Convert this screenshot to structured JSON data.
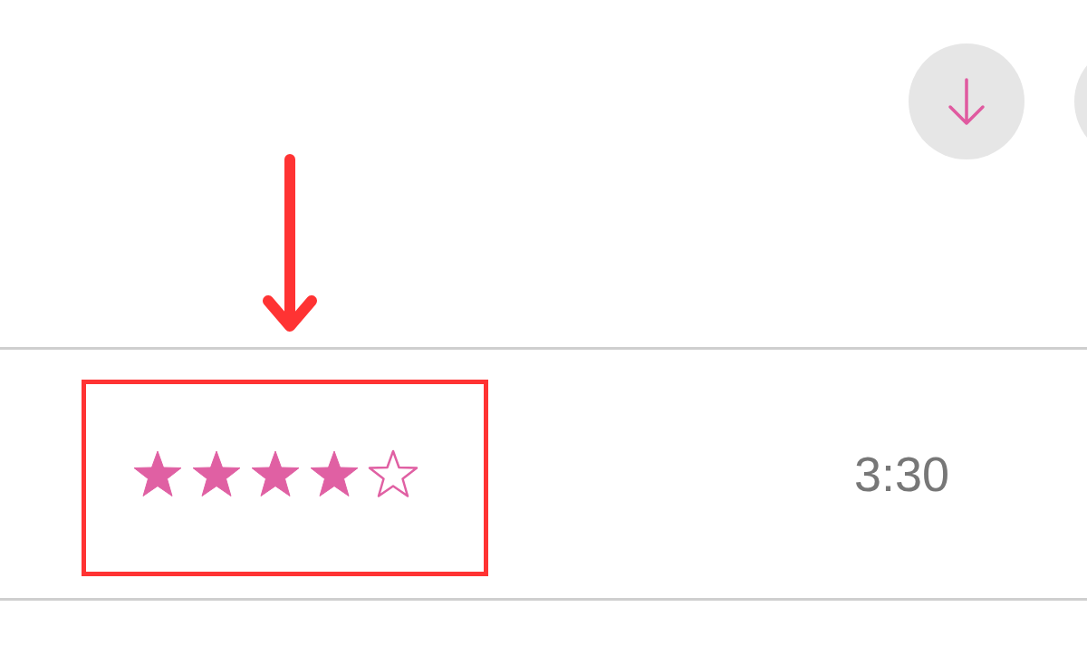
{
  "track": {
    "stars": 4,
    "duration": "3:30"
  }
}
